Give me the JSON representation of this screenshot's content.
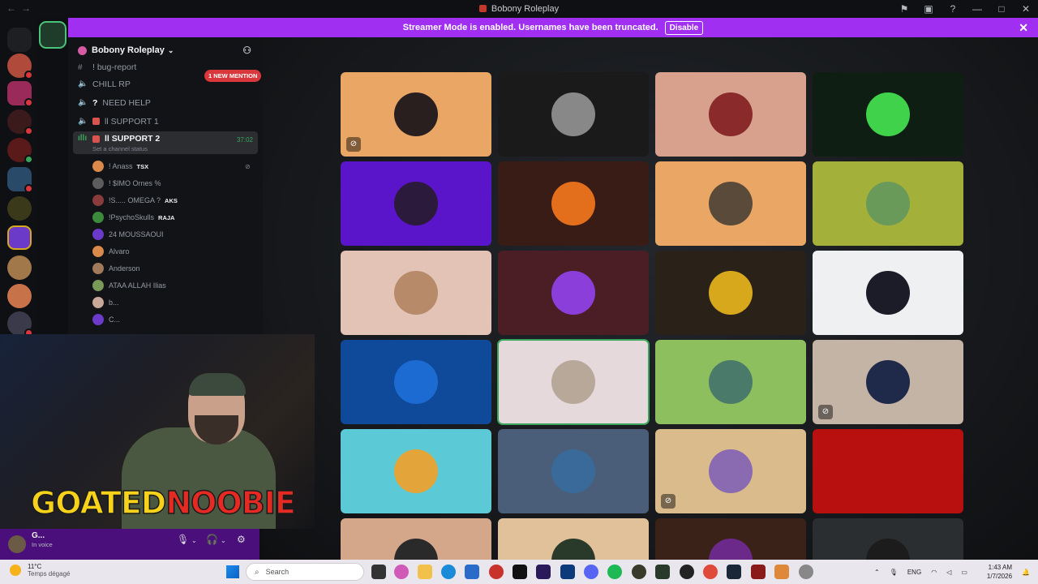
{
  "window": {
    "title": "Bobony Roleplay"
  },
  "banner": {
    "text": "Streamer Mode is enabled. Usernames have been truncated.",
    "disable_label": "Disable"
  },
  "server": {
    "name": "Bobony Roleplay"
  },
  "channels": [
    {
      "icon": "#",
      "label": "! bug-report"
    },
    {
      "icon": "🔊",
      "label": "CHILL RP"
    },
    {
      "icon": "🔊",
      "label": "NEED HELP",
      "prefix": "?"
    },
    {
      "icon": "🔊",
      "label": "ll SUPPORT 1"
    },
    {
      "icon": "🔊",
      "label": "ll SUPPORT 2",
      "time": "37:02",
      "status": "Set a channel status"
    }
  ],
  "mention_badge": "1 NEW MENTION",
  "members": [
    {
      "name": "! Anass",
      "tag": "TSX",
      "color": "#d98a4a"
    },
    {
      "name": "! $IMO Ornes %",
      "color": "#5c5c5c"
    },
    {
      "name": "!S..... OMEGA ?",
      "tag": "AKS",
      "color": "#8a3b3b"
    },
    {
      "name": "!PsychoSkulls",
      "tag": "RAJA",
      "color": "#3c8a3c"
    },
    {
      "name": "24 MOUSSAOUI",
      "color": "#6b3ac9"
    },
    {
      "name": "Alvaro",
      "color": "#d98a4a"
    },
    {
      "name": "Anderson",
      "color": "#a07a5a"
    },
    {
      "name": "ATAA ALLAH Ilias",
      "color": "#7a9a5a"
    },
    {
      "name": "b...",
      "color": "#c8a898"
    },
    {
      "name": "C...",
      "color": "#6b3ac9"
    }
  ],
  "user_panel": {
    "name": "G...",
    "status": "In voice"
  },
  "overlay": {
    "part1": "GOATED",
    "part2": "NOOBIE"
  },
  "tiles": [
    {
      "bg": "#e9a665",
      "av": "#2a1f1f",
      "muted": true
    },
    {
      "bg": "#1a1a1b",
      "av": "#888",
      "muted": false
    },
    {
      "bg": "#d7a18e",
      "av": "#8a2a2a",
      "muted": false
    },
    {
      "bg": "#0f1e12",
      "av": "#3fd24a",
      "muted": false
    },
    {
      "bg": "#5a14c9",
      "av": "#2b1a3b",
      "muted": false
    },
    {
      "bg": "#3a1c16",
      "av": "#e36e1c",
      "muted": false
    },
    {
      "bg": "#e9a665",
      "av": "#5a4a3a",
      "muted": false
    },
    {
      "bg": "#a3b03a",
      "av": "#6a9a5a",
      "muted": false
    },
    {
      "bg": "#e3c3b6",
      "av": "#b78a6a",
      "muted": false
    },
    {
      "bg": "#4a1e24",
      "av": "#8b3ed9",
      "muted": false
    },
    {
      "bg": "#2a2218",
      "av": "#d8a81c",
      "muted": false
    },
    {
      "bg": "#eef0f2",
      "av": "#1c1c28",
      "muted": false
    },
    {
      "bg": "#0f4a9a",
      "av": "#1b6bd2",
      "muted": false
    },
    {
      "bg": "#e6d9dc",
      "av": "#b8a89a",
      "muted": false,
      "speaking": true
    },
    {
      "bg": "#8dbf5e",
      "av": "#4a7a6a",
      "muted": false
    },
    {
      "bg": "#c4b4a6",
      "av": "#1f2a4a",
      "muted": true
    },
    {
      "bg": "#5bcad6",
      "av": "#e3a53a",
      "muted": false
    },
    {
      "bg": "#4a5e7a",
      "av": "#3a6a9a",
      "muted": false
    },
    {
      "bg": "#d9bb8c",
      "av": "#8a6ab0",
      "muted": true
    },
    {
      "bg": "#b80f0f",
      "av": "#b80f0f",
      "muted": false
    },
    {
      "bg": "#d4a68a",
      "av": "#2a2a2a",
      "muted": false
    },
    {
      "bg": "#e0c19a",
      "av": "#2a3a2a",
      "muted": false
    },
    {
      "bg": "#3a2218",
      "av": "#6b2a8a",
      "muted": false
    },
    {
      "bg": "#2a2e30",
      "av": "#1c1c1c",
      "muted": false
    }
  ],
  "taskbar": {
    "weather_temp": "11°C",
    "weather_desc": "Temps dégagé",
    "search_placeholder": "Search",
    "lang": "ENG",
    "time": "1:43 AM",
    "date": "1/7/2026"
  }
}
